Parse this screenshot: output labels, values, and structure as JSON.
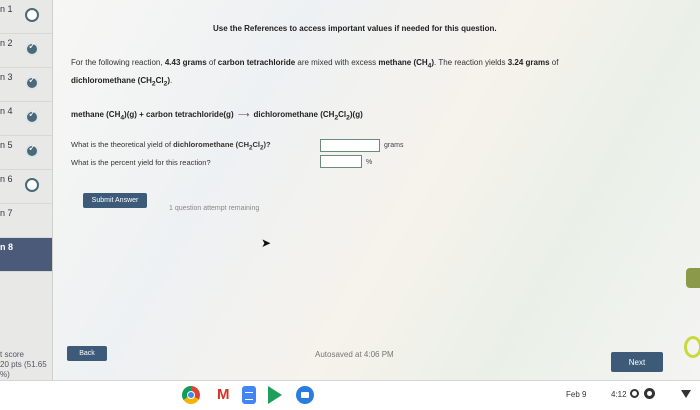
{
  "sidebar": {
    "items": [
      {
        "label": "n 1",
        "status": "empty"
      },
      {
        "label": "n 2",
        "status": "done"
      },
      {
        "label": "n 3",
        "status": "done"
      },
      {
        "label": "n 4",
        "status": "done"
      },
      {
        "label": "n 5",
        "status": "done"
      },
      {
        "label": "n 6",
        "status": "empty"
      },
      {
        "label": "n 7",
        "status": "none"
      },
      {
        "label": "n 8",
        "status": "active"
      }
    ],
    "score_label": "t score",
    "score_value": "20 pts (51.65 %)"
  },
  "main": {
    "references_note": "Use the References to access important values if needed for this question.",
    "problem": {
      "intro": "For the following reaction,",
      "mass1": "4.43 grams",
      "of": "of",
      "reactant1": "carbon tetrachloride",
      "mixed": "are mixed with excess",
      "reactant2": "methane (CH",
      "r2_sub": "4",
      "r2_end": ")",
      "yields_text": ". The reaction yields",
      "yield_mass": "3.24 grams",
      "of2": "of",
      "product": "dichloromethane (CH",
      "p_sub1": "2",
      "p_mid": "Cl",
      "p_sub2": "2",
      "p_end": ")",
      "period": "."
    },
    "reaction": {
      "left": "methane (CH",
      "left_sub": "4",
      "left_end": ")(g) + carbon tetrachloride(g)",
      "arrow": "⟶",
      "right": "dichloromethane (CH",
      "right_sub1": "2",
      "right_mid": "Cl",
      "right_sub2": "2",
      "right_end": ")(g)"
    },
    "q1": {
      "text_start": "What is the theoretical yield of",
      "bold": "dichloromethane (CH",
      "sub1": "2",
      "mid": "Cl",
      "sub2": "2",
      "end": ")?",
      "value": "",
      "unit": "grams"
    },
    "q2": {
      "text": "What is the percent yield for this reaction?",
      "value": "",
      "unit": "%"
    },
    "submit_label": "Submit Answer",
    "attempts_text": "1 question attempt remaining",
    "back_label": "Back",
    "autosave_text": "Autosaved at 4:06 PM",
    "next_label": "Next"
  },
  "taskbar": {
    "date": "Feb 9",
    "time": "4:12",
    "gmail_letter": "M"
  },
  "colors": {
    "accent": "#3d5a78",
    "sidebar_active": "#4a5a78"
  }
}
